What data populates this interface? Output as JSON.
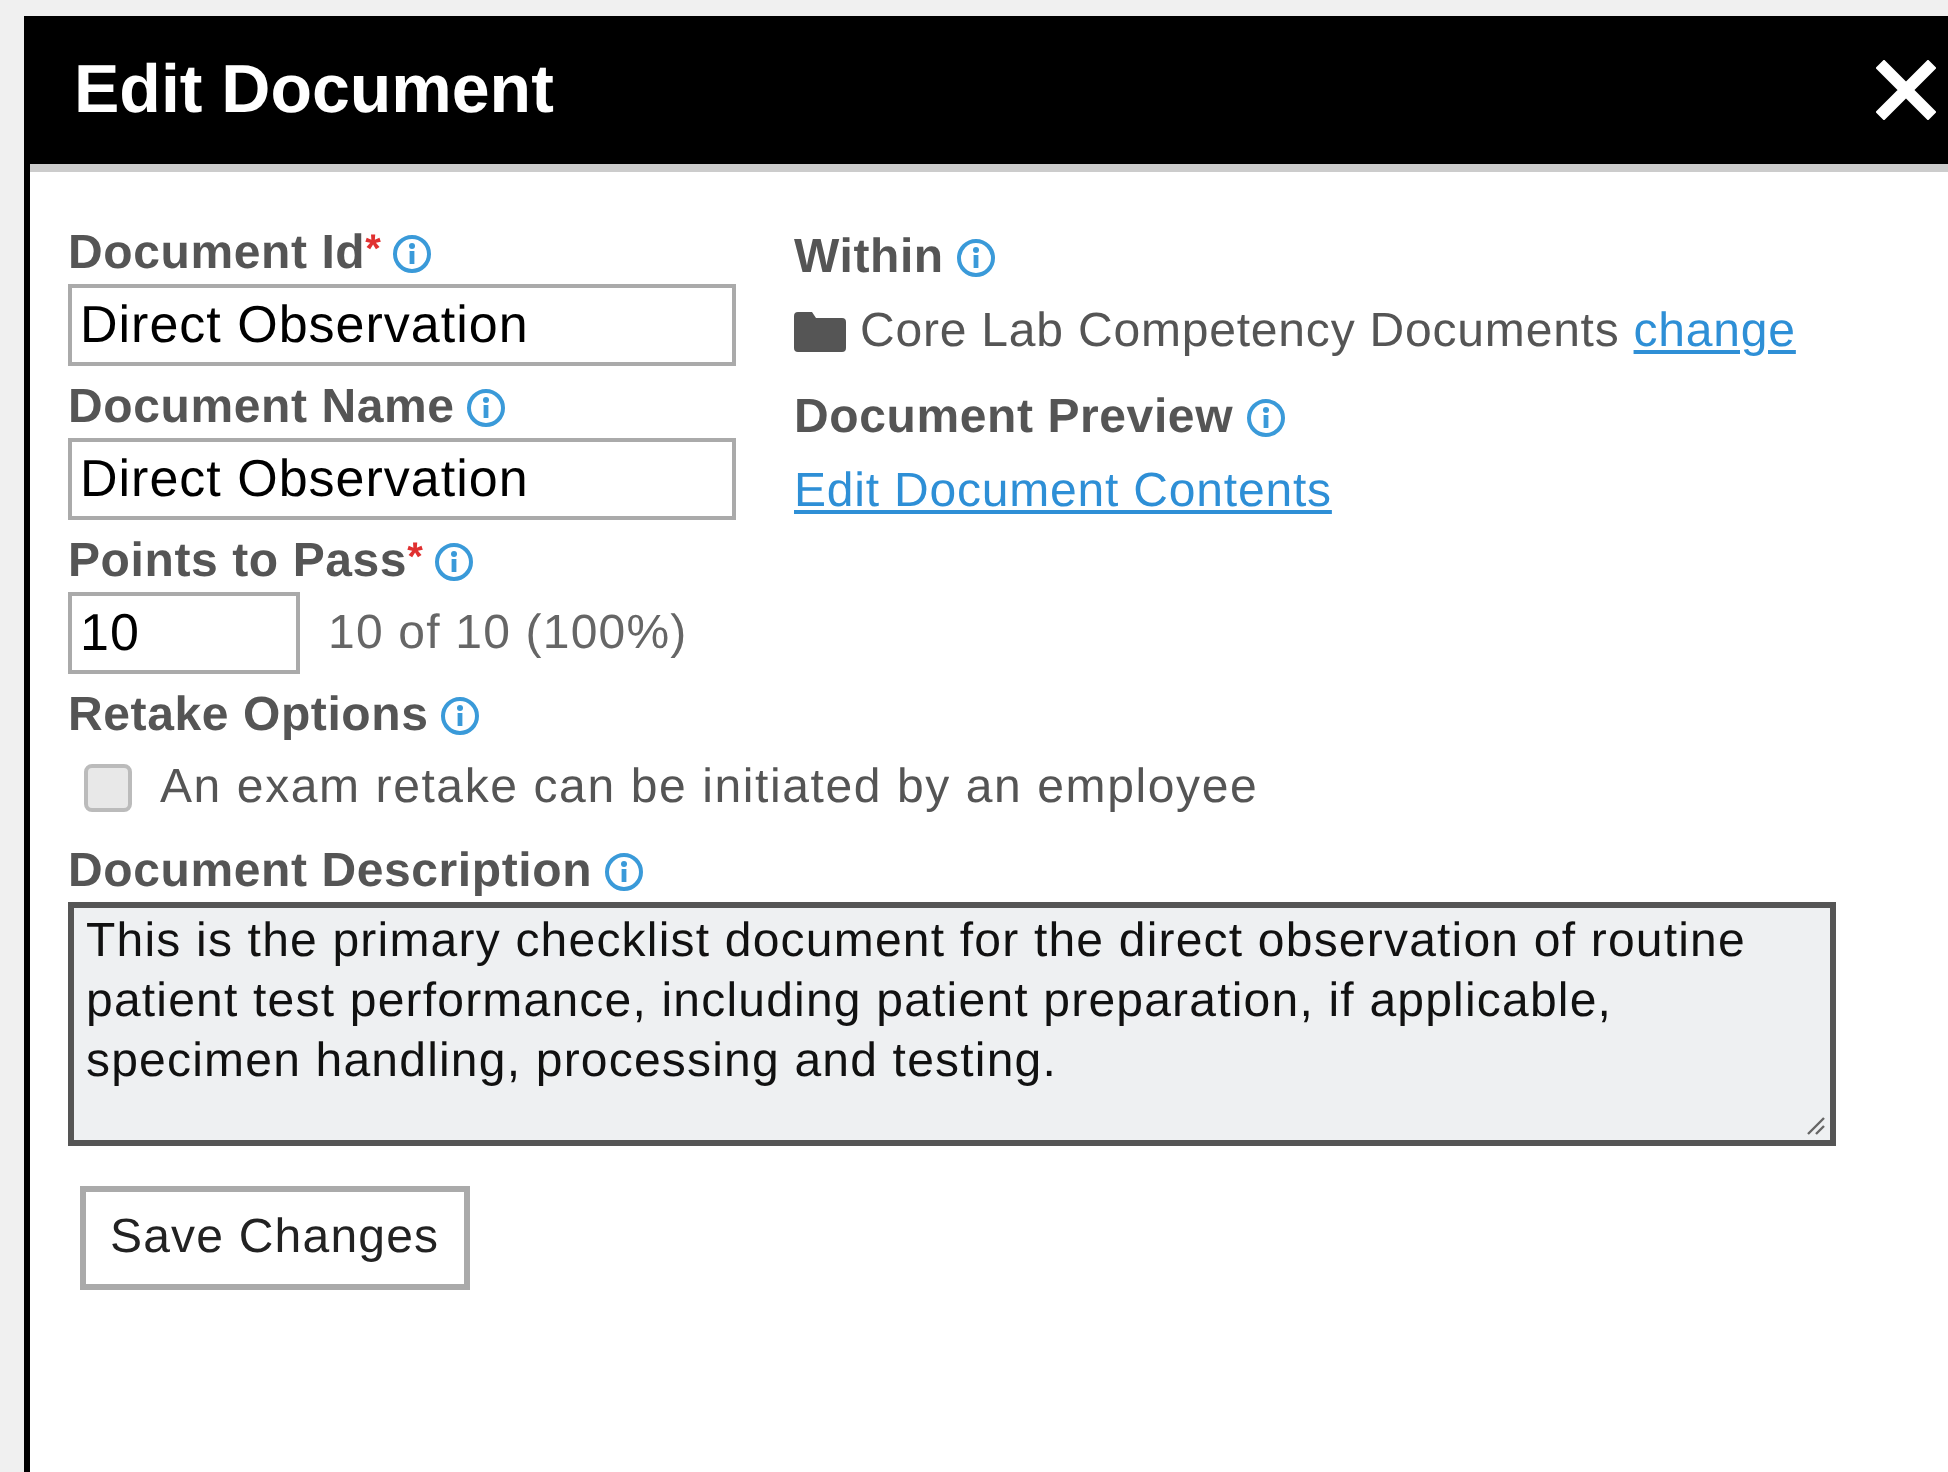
{
  "window": {
    "title": "Edit Document"
  },
  "fields": [
    {
      "kind": "input",
      "label": "Document Id",
      "required_mark": "*",
      "value": "Direct Observation"
    },
    {
      "kind": "input",
      "label": "Document Name",
      "value": "Direct Observation"
    }
  ],
  "within": {
    "label": "Within",
    "folder": "Core Lab Competency Documents",
    "link": "change"
  },
  "preview": {
    "label": "Document Preview",
    "link": "Edit Document Contents"
  },
  "points": {
    "label": "Points to Pass",
    "required_mark": "*",
    "value": "10",
    "summary": "10 of 10 (100%)"
  },
  "retake": {
    "label": "Retake Options",
    "option": "An exam retake can be initiated by an employee",
    "checked": false
  },
  "description": {
    "label": "Document Description",
    "value": "This is the primary checklist document for the direct observation of routine patient test performance, including patient preparation, if applicable, specimen handling, processing and testing."
  },
  "buttons": [
    "Save Changes"
  ]
}
